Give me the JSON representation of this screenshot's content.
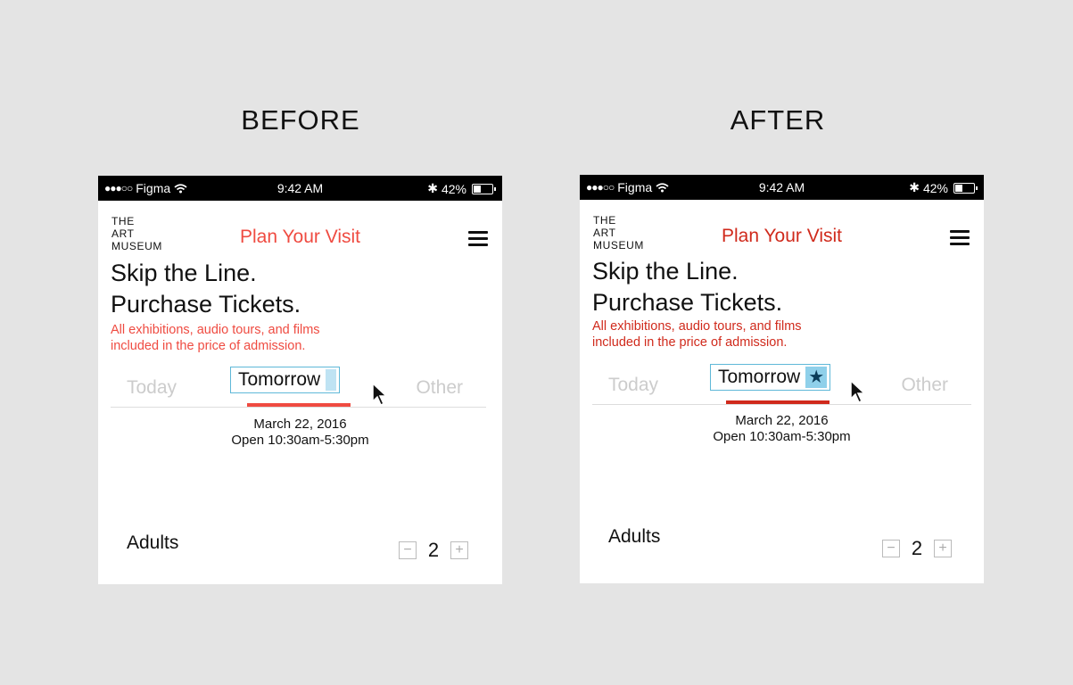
{
  "labels": {
    "before": "BEFORE",
    "after": "AFTER"
  },
  "status_bar": {
    "carrier": "Figma",
    "signal_dots": "●●●○○",
    "time": "9:42 AM",
    "bluetooth": "✱",
    "battery": "42%"
  },
  "header": {
    "logo_lines": [
      "THE",
      "ART",
      "MUSEUM"
    ],
    "title": "Plan Your Visit"
  },
  "headline": [
    "Skip the Line.",
    "Purchase Tickets."
  ],
  "subtitle": [
    "All exhibitions, audio tours, and films",
    "included in the price of admission."
  ],
  "tabs": {
    "today": "Today",
    "tomorrow": "Tomorrow",
    "other": "Other",
    "after_marker": "★"
  },
  "date_info": {
    "date": "March 22, 2016",
    "hours": "Open 10:30am-5:30pm"
  },
  "adults": {
    "label": "Adults",
    "count": "2",
    "minus": "−",
    "plus": "+"
  },
  "colors": {
    "before_accent": "#ef4b41",
    "after_accent": "#d02a1c"
  }
}
